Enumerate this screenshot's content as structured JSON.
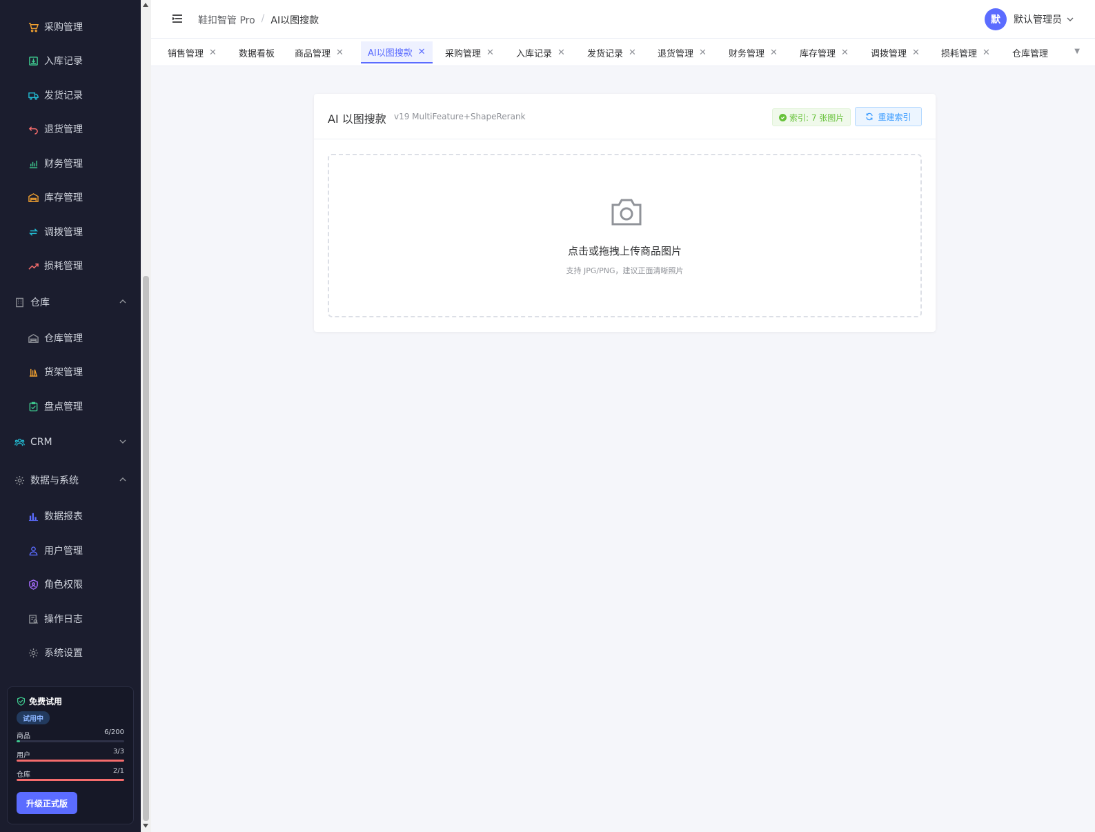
{
  "sidebar": {
    "items": [
      {
        "label": "采购管理",
        "icon": "cart-icon",
        "color": "#f0a030"
      },
      {
        "label": "入库记录",
        "icon": "inbox-icon",
        "color": "#3ec98f"
      },
      {
        "label": "发货记录",
        "icon": "truck-icon",
        "color": "#22b8cf"
      },
      {
        "label": "退货管理",
        "icon": "return-icon",
        "color": "#f56c6c"
      },
      {
        "label": "财务管理",
        "icon": "finance-icon",
        "color": "#3ec98f"
      },
      {
        "label": "库存管理",
        "icon": "warehouse-icon",
        "color": "#f0a030"
      },
      {
        "label": "调拨管理",
        "icon": "transfer-icon",
        "color": "#22b8cf"
      },
      {
        "label": "损耗管理",
        "icon": "trend-icon",
        "color": "#f56c6c"
      }
    ],
    "group_warehouse": {
      "label": "仓库",
      "icon": "building-icon"
    },
    "warehouse_items": [
      {
        "label": "仓库管理",
        "icon": "warehouse-icon",
        "color": "#909399"
      },
      {
        "label": "货架管理",
        "icon": "shelf-icon",
        "color": "#f0a030"
      },
      {
        "label": "盘点管理",
        "icon": "clipboard-check-icon",
        "color": "#3ec98f"
      }
    ],
    "group_crm": {
      "label": "CRM",
      "icon": "users-icon",
      "color": "#22b8cf"
    },
    "group_system": {
      "label": "数据与系统",
      "icon": "gear-icon"
    },
    "system_items": [
      {
        "label": "数据报表",
        "icon": "bar-chart-icon",
        "color": "#5b6cff"
      },
      {
        "label": "用户管理",
        "icon": "user-icon",
        "color": "#5b6cff"
      },
      {
        "label": "角色权限",
        "icon": "shield-user-icon",
        "color": "#a66cff"
      },
      {
        "label": "操作日志",
        "icon": "log-icon",
        "color": "#909399"
      },
      {
        "label": "系统设置",
        "icon": "gear-icon",
        "color": "#909399"
      }
    ],
    "trial": {
      "title": "免费试用",
      "badge": "试用中",
      "quotas": [
        {
          "label": "商品",
          "value": "6/200",
          "fraction": 0.03,
          "color": "#3ec98f"
        },
        {
          "label": "用户",
          "value": "3/3",
          "fraction": 1.0,
          "color": "#f56c6c"
        },
        {
          "label": "仓库",
          "value": "2/1",
          "fraction": 1.0,
          "color": "#f56c6c"
        }
      ],
      "upgrade_label": "升级正式版"
    }
  },
  "header": {
    "breadcrumb": [
      "鞋扣智管 Pro",
      "AI以图搜款"
    ],
    "separator": "/",
    "user_initial": "默",
    "user_name": "默认管理员"
  },
  "tabs": [
    {
      "label": "销售管理",
      "closable": true
    },
    {
      "label": "数据看板",
      "closable": false
    },
    {
      "label": "商品管理",
      "closable": true
    },
    {
      "label": "AI以图搜款",
      "closable": true,
      "active": true
    },
    {
      "label": "采购管理",
      "closable": true
    },
    {
      "label": "入库记录",
      "closable": true
    },
    {
      "label": "发货记录",
      "closable": true
    },
    {
      "label": "退货管理",
      "closable": true
    },
    {
      "label": "财务管理",
      "closable": true
    },
    {
      "label": "库存管理",
      "closable": true
    },
    {
      "label": "调拨管理",
      "closable": true
    },
    {
      "label": "损耗管理",
      "closable": true
    },
    {
      "label": "仓库管理",
      "closable": false
    }
  ],
  "card": {
    "title": "AI 以图搜款",
    "subtitle": "v19 MultiFeature+ShapeRerank",
    "index_badge": "索引: 7 张图片",
    "rebuild_label": "重建索引",
    "upload_title": "点击或拖拽上传商品图片",
    "upload_hint": "支持 JPG/PNG，建议正面清晰照片"
  },
  "colors": {
    "accent": "#5b6cff",
    "sidebar_bg": "#1b1d2e",
    "success": "#67c23a"
  }
}
